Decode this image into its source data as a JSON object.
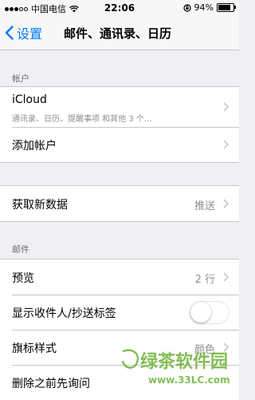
{
  "status_bar": {
    "carrier": "中国电信",
    "time": "22:06",
    "battery_percent_label": "94%",
    "battery_level": 0.94
  },
  "nav": {
    "back_label": "设置",
    "title": "邮件、通讯录、日历"
  },
  "accounts_section": {
    "header": "帐户",
    "icloud": {
      "title": "iCloud",
      "subtitle": "通讯录、日历、提醒事项 和其他 3 个..."
    },
    "add_account": "添加帐户"
  },
  "fetch_row": {
    "title": "获取新数据",
    "value": "推送"
  },
  "mail_section": {
    "header": "邮件",
    "preview": {
      "title": "预览",
      "value": "2 行"
    },
    "show_to_cc": {
      "title": "显示收件人/抄送标签",
      "on": false
    },
    "flag_style": {
      "title": "旗标样式",
      "value": "颜色"
    },
    "ask_before_delete": {
      "title": "删除之前先询问"
    }
  },
  "watermark": {
    "text": "绿茶软件园",
    "url": "www.33LC.com"
  },
  "colors": {
    "accent": "#007aff",
    "background": "#efeff4",
    "separator": "#c8c7cc",
    "watermark": "#6fb23a"
  }
}
